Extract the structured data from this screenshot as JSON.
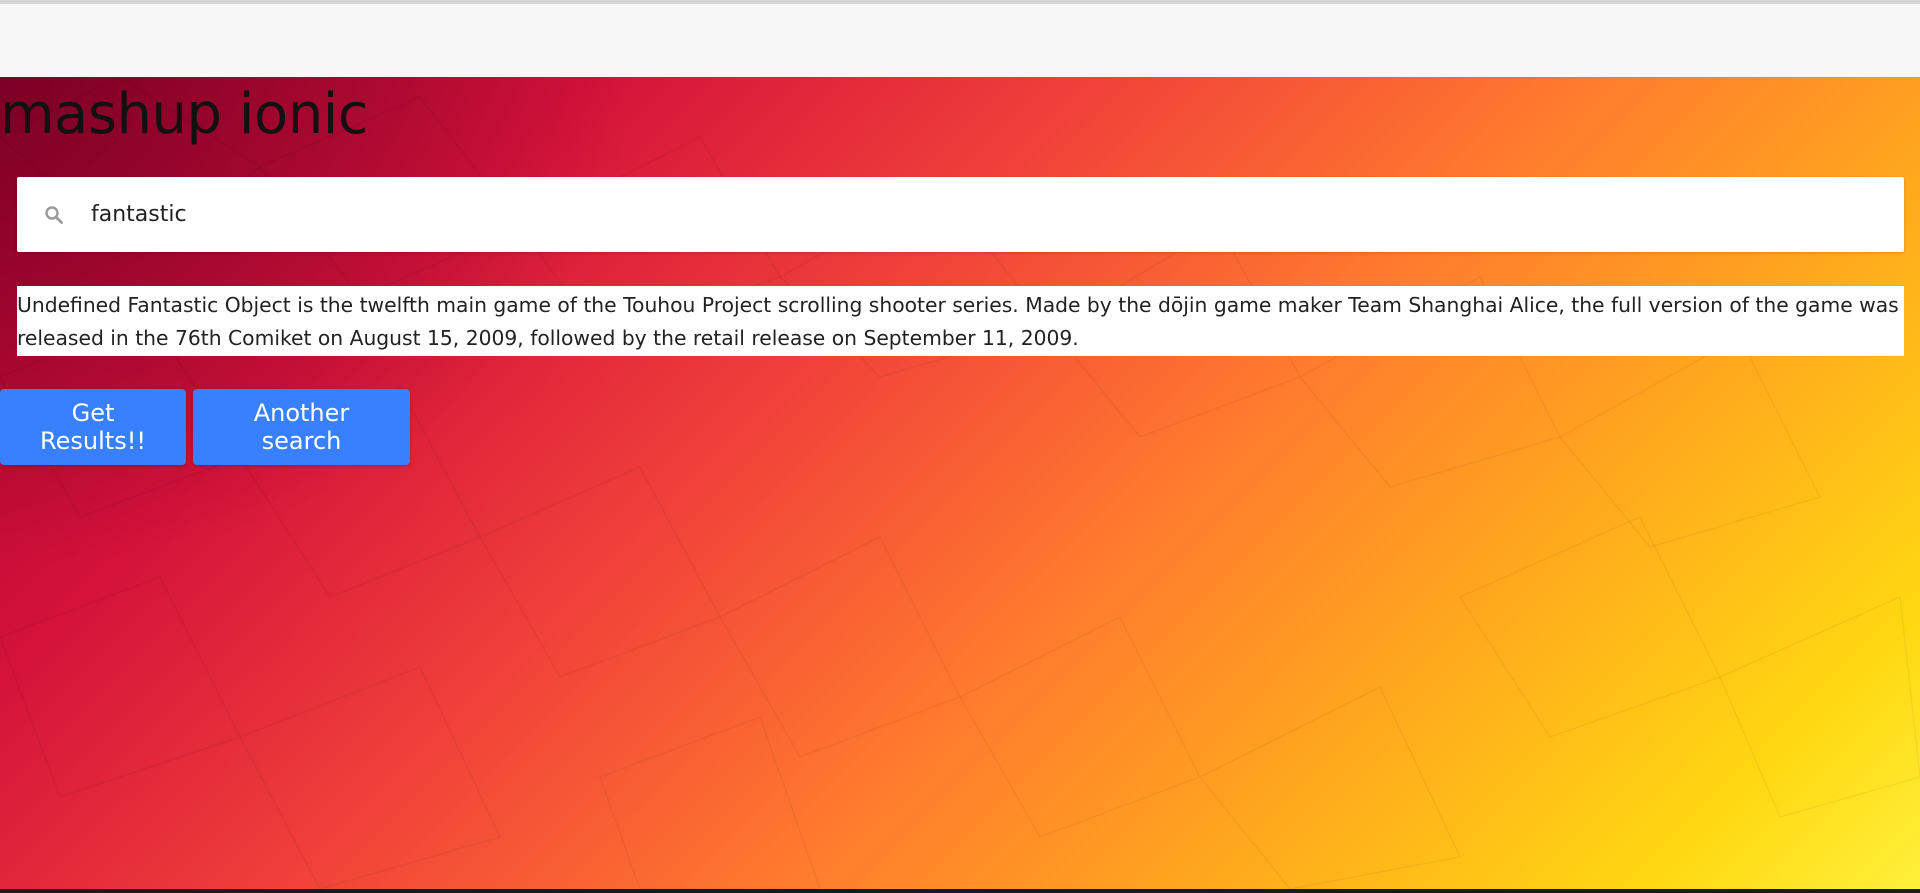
{
  "app": {
    "title": "mashup ionic"
  },
  "search": {
    "value": "fantastic",
    "icon": "search-icon"
  },
  "result": {
    "text": "Undefined Fantastic Object is the twelfth main game of the Touhou Project scrolling shooter series. Made by the dōjin game maker Team Shanghai Alice, the full version of the game was released in the 76th Comiket on August 15, 2009, followed by the retail release on September 11, 2009."
  },
  "buttons": {
    "get_results": "Get Results!!",
    "another_search": "Another search"
  },
  "colors": {
    "primary": "#3880ff",
    "background_start": "#a4002e",
    "background_end": "#fff03a"
  }
}
